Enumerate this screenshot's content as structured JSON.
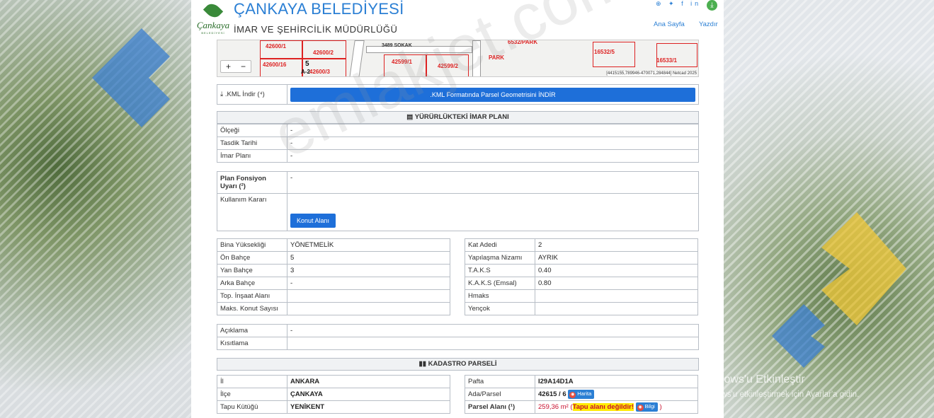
{
  "header": {
    "logo_name": "Çankaya",
    "logo_sub": "BELEDİYESİ",
    "title": "ÇANKAYA BELEDİYESİ",
    "subtitle": "İMAR VE ŞEHİRCİLİK MÜDÜRLÜĞÜ",
    "social": "⊕ ✦ f in",
    "nav_home": "Ana Sayfa",
    "nav_print": "Yazdır"
  },
  "map": {
    "labels": [
      "42600/1",
      "42600/2",
      "42600/16",
      "5",
      "42600/3",
      "42599/1",
      "42599/2",
      "3489 SOKAK",
      "6532/PARK",
      "16532/5",
      "16533/1",
      "PARK",
      "A-2"
    ],
    "credit": "[4415155,789946-470071,284844] Netcad 2025",
    "zoom_in": "+",
    "zoom_out": "−"
  },
  "kml": {
    "label": ".KML İndir (⁴)",
    "button": ".KML Formatında Parsel Geometrisini İNDİR"
  },
  "imar": {
    "heading": "YÜRÜRLÜKTEKİ İMAR PLANI",
    "rows": [
      {
        "k": "Ölçeği",
        "v": "-"
      },
      {
        "k": "Tasdik Tarihi",
        "v": "-"
      },
      {
        "k": "İmar Planı",
        "v": "-"
      }
    ]
  },
  "plan": {
    "warning_label": "Plan Fonsiyon Uyarı (²)",
    "warning_value": "-",
    "usage_label": "Kullanım Kararı",
    "usage_button": "Konut Alanı"
  },
  "build_left": [
    {
      "k": "Bina Yüksekliği",
      "v": "YÖNETMELİK"
    },
    {
      "k": "Ön Bahçe",
      "v": "5"
    },
    {
      "k": "Yan Bahçe",
      "v": "3"
    },
    {
      "k": "Arka Bahçe",
      "v": "-"
    },
    {
      "k": "Top. İnşaat Alanı",
      "v": ""
    },
    {
      "k": "Maks. Konut Sayısı",
      "v": ""
    }
  ],
  "build_right": [
    {
      "k": "Kat Adedi",
      "v": "2"
    },
    {
      "k": "Yapılaşma Nizamı",
      "v": "AYRIK"
    },
    {
      "k": "T.A.K.S",
      "v": "0.40"
    },
    {
      "k": "K.A.K.S (Emsal)",
      "v": "0.80"
    },
    {
      "k": "Hmaks",
      "v": ""
    },
    {
      "k": "Yençok",
      "v": ""
    }
  ],
  "notes": [
    {
      "k": "Açıklama",
      "v": "-"
    },
    {
      "k": "Kısıtlama",
      "v": ""
    }
  ],
  "kadastro": {
    "heading": "KADASTRO PARSELİ",
    "left": [
      {
        "k": "İl",
        "v": "ANKARA"
      },
      {
        "k": "İlçe",
        "v": "ÇANKAYA"
      },
      {
        "k": "Tapu Kütüğü",
        "v": "YENİKENT"
      }
    ],
    "pafta_label": "Pafta",
    "pafta_value": "I29A14D1A",
    "ada_label": "Ada/Parsel",
    "ada_value": "42615 / 6",
    "harita": "Harita",
    "alan_label": "Parsel Alanı (¹)",
    "alan_value": "259,36 m²",
    "alan_warn": "Tapu alanı değildir!",
    "bilgi": "Bilgi"
  },
  "watermark": "emlakjet.com",
  "windows": {
    "line1": "Windows'u Etkinleştir",
    "line2": "Windows'u etkinleştirmek için Ayarlar'a gidin."
  }
}
